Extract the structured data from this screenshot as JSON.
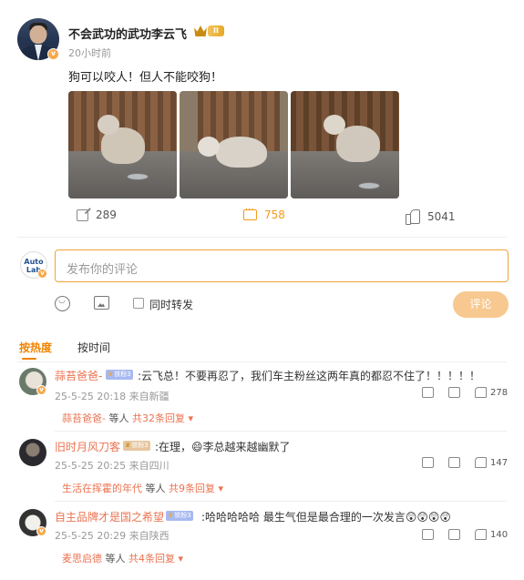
{
  "post": {
    "author": "不会武功的武功李云飞",
    "level_badge": "II",
    "time": "20小时前",
    "text": "狗可以咬人！但人不能咬狗！",
    "verified_mark": "v",
    "images": [
      "dog-photo-1",
      "dog-photo-2",
      "dog-photo-3"
    ],
    "reposts": "289",
    "comments": "758",
    "likes": "5041"
  },
  "composer": {
    "avatar_text_1": "Auto",
    "avatar_text_2": "Lab",
    "placeholder": "发布你的评论",
    "repost_label": "同时转发",
    "submit_label": "评论"
  },
  "sort": {
    "hot": "按热度",
    "time": "按时间"
  },
  "comments": [
    {
      "user": "蒜苔爸爸-",
      "fan_badge": "铁粉3",
      "text": ":云飞总！不要再忍了，我们车主粉丝这两年真的都忍不住了！！！！！",
      "time": "25-5-25 20:18",
      "location": "来自新疆",
      "likes": "278",
      "reply_user": "蒜苔爸爸-",
      "reply_mid": "等人",
      "reply_count": "共32条回复"
    },
    {
      "user": "旧时月风刀客",
      "fan_badge": "铁粉3",
      "text": ":在理，😄李总越来越幽默了",
      "time": "25-5-25 20:25",
      "location": "来自四川",
      "likes": "147",
      "reply_user": "生活在挥霍的年代",
      "reply_mid": "等人",
      "reply_count": "共9条回复"
    },
    {
      "user": "自主品牌才是国之希望",
      "fan_badge": "铁粉3",
      "text": ":哈哈哈哈哈 最生气但是最合理的一次发言😲😲😲😲",
      "time": "25-5-25 20:29",
      "location": "来自陕西",
      "likes": "140",
      "reply_user": "麦思启德",
      "reply_mid": "等人",
      "reply_count": "共4条回复"
    }
  ],
  "colors": {
    "accent": "#f08300",
    "name": "#eb7350",
    "submit_bg": "#f7c88f"
  }
}
